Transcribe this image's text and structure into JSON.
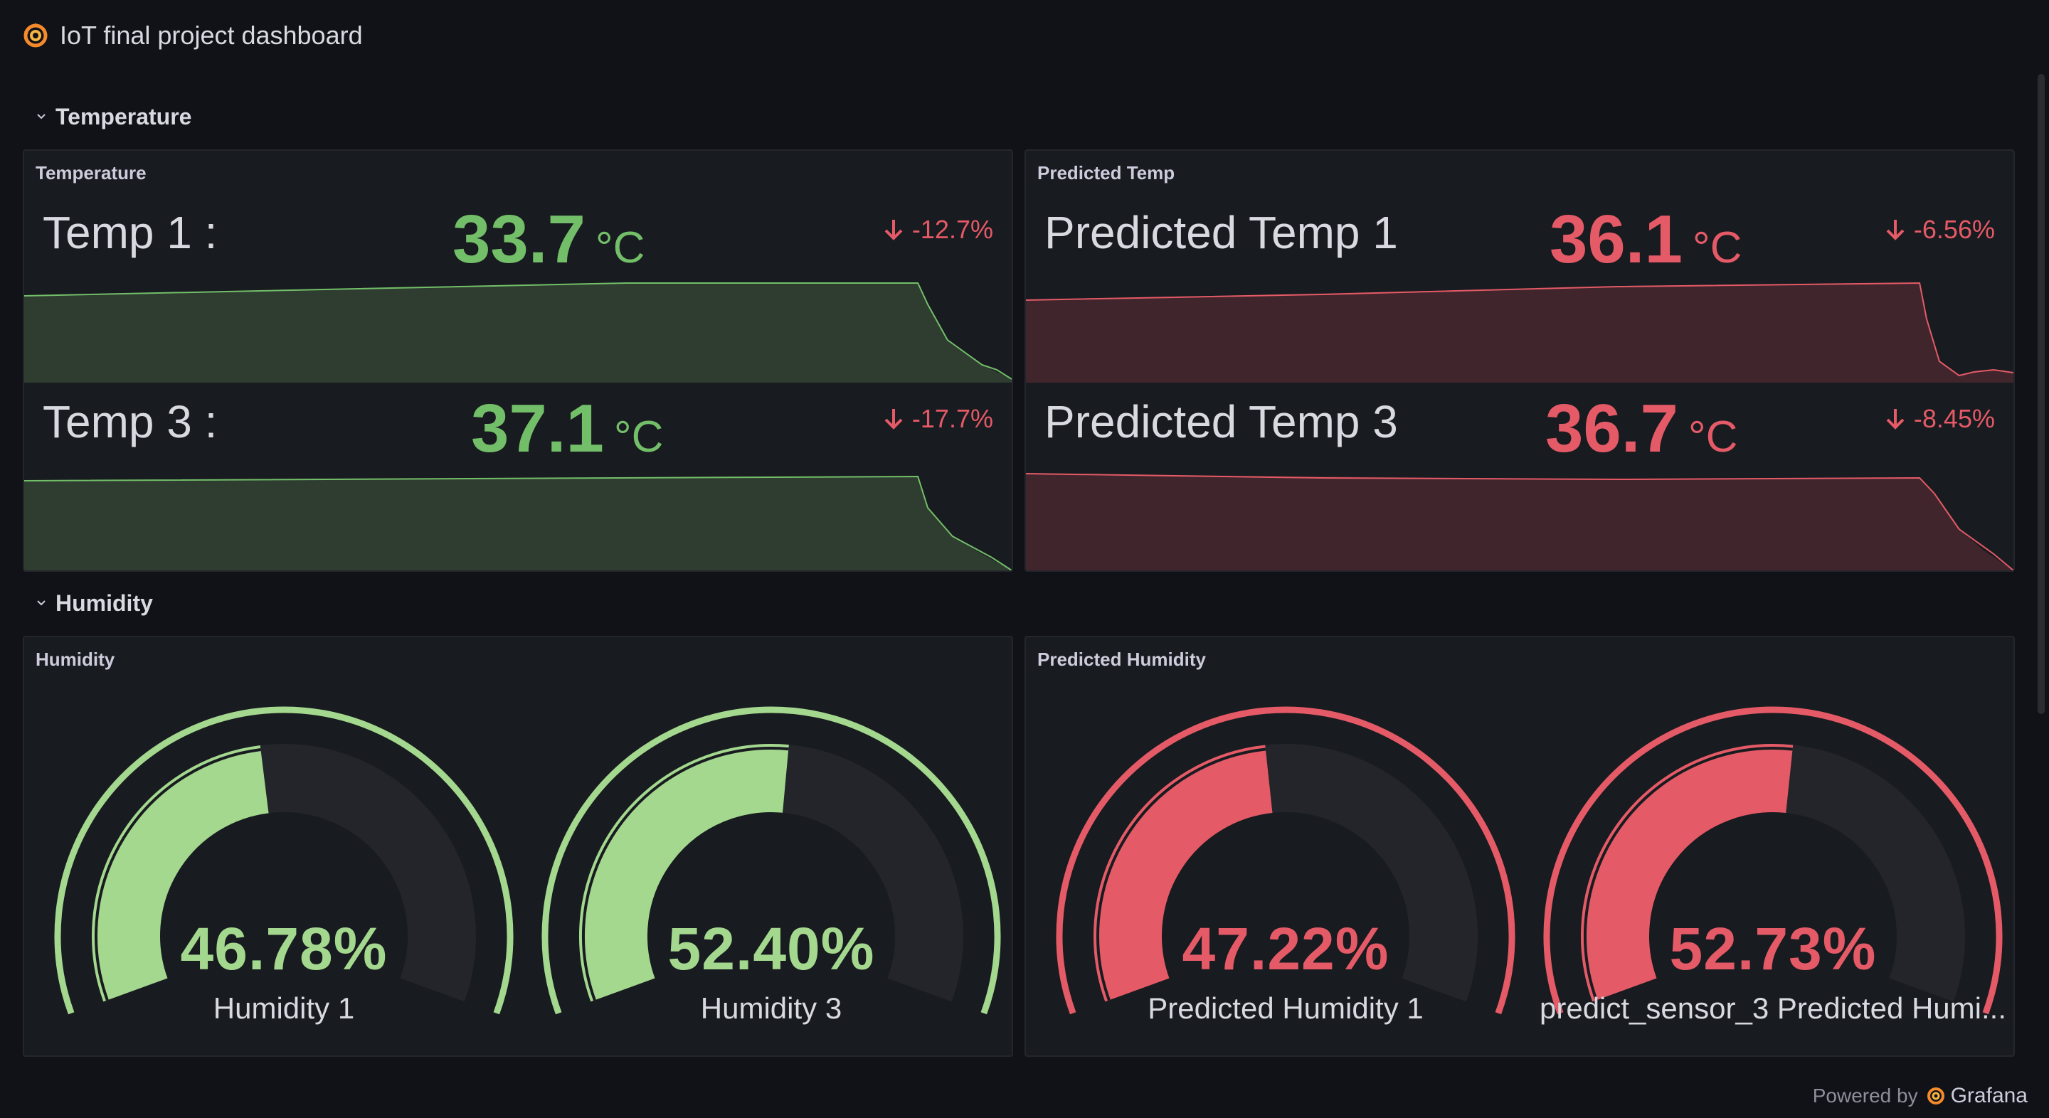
{
  "dashboard": {
    "title": "IoT final project dashboard"
  },
  "rows": {
    "temperature": {
      "label": "Temperature"
    },
    "humidity": {
      "label": "Humidity"
    }
  },
  "panels": {
    "temperature": {
      "title": "Temperature",
      "stats": [
        {
          "name": "Temp 1 :",
          "value": "33.7",
          "unit": "°C",
          "change": "-12.7%"
        },
        {
          "name": "Temp 3 :",
          "value": "37.1",
          "unit": "°C",
          "change": "-17.7%"
        }
      ]
    },
    "predicted_temp": {
      "title": "Predicted Temp",
      "stats": [
        {
          "name": "Predicted Temp 1",
          "value": "36.1",
          "unit": "°C",
          "change": "-6.56%"
        },
        {
          "name": "Predicted Temp 3",
          "value": "36.7",
          "unit": "°C",
          "change": "-8.45%"
        }
      ]
    },
    "humidity": {
      "title": "Humidity",
      "gauges": [
        {
          "label": "Humidity 1",
          "value_text": "46.78%",
          "value": 46.78
        },
        {
          "label": "Humidity 3",
          "value_text": "52.40%",
          "value": 52.4
        }
      ]
    },
    "predicted_humidity": {
      "title": "Predicted Humidity",
      "gauges": [
        {
          "label": "Predicted Humidity 1",
          "value_text": "47.22%",
          "value": 47.22
        },
        {
          "label": "predict_sensor_3 Predicted Humi...",
          "value_text": "52.73%",
          "value": 52.73
        }
      ]
    }
  },
  "footer": {
    "powered_by": "Powered by",
    "brand": "Grafana"
  },
  "colors": {
    "good": "#73bf69",
    "good_light": "#a3d88e",
    "bad": "#e55a67",
    "good_fill": "#2f3d31",
    "bad_fill": "#40262c",
    "gauge_track": "#23252b"
  }
}
